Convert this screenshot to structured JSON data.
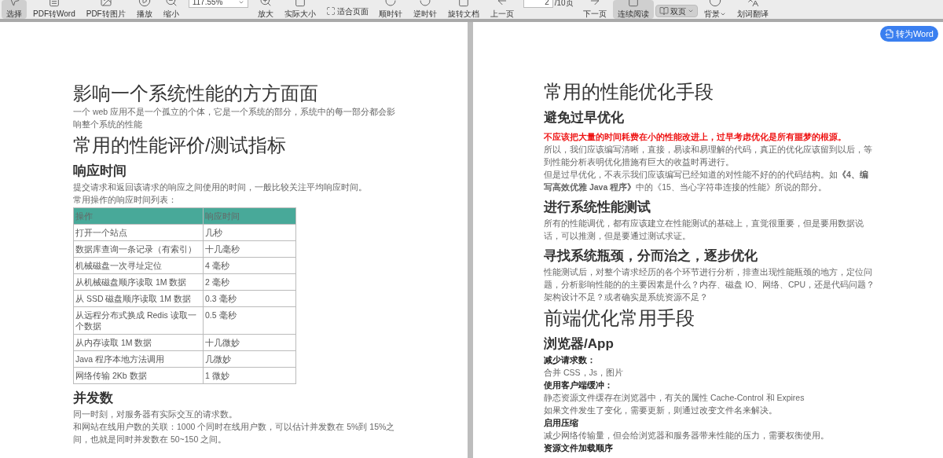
{
  "toolbar": [
    {
      "kind": "button",
      "label": "选择",
      "selected": true,
      "dropdown": false
    },
    {
      "kind": "button",
      "label": "PDF转Word",
      "selected": false,
      "dropdown": false
    },
    {
      "kind": "button",
      "label": "PDF转图片",
      "selected": false,
      "dropdown": false
    },
    {
      "kind": "button",
      "label": "播放",
      "selected": false,
      "dropdown": false
    },
    {
      "kind": "button",
      "label": "缩小",
      "selected": false,
      "dropdown": false
    },
    {
      "kind": "zoom",
      "value": "117.55%"
    },
    {
      "kind": "button",
      "label": "放大",
      "selected": false,
      "dropdown": false
    },
    {
      "kind": "button",
      "label": "实际大小",
      "selected": false,
      "dropdown": false
    },
    {
      "kind": "inline",
      "label": "适合页面",
      "selected": false,
      "dropdown": false
    },
    {
      "kind": "button",
      "label": "顺时针",
      "selected": false,
      "dropdown": false
    },
    {
      "kind": "button",
      "label": "逆时针",
      "selected": false,
      "dropdown": false
    },
    {
      "kind": "button",
      "label": "旋转文档",
      "selected": false,
      "dropdown": false
    },
    {
      "kind": "button",
      "label": "上一页",
      "selected": false,
      "dropdown": false
    },
    {
      "kind": "page",
      "value": "2",
      "total": "/10页"
    },
    {
      "kind": "button",
      "label": "下一页",
      "selected": false,
      "dropdown": false
    },
    {
      "kind": "button",
      "label": "连续阅读",
      "selected": true,
      "dropdown": false
    },
    {
      "kind": "inline",
      "label": "双页",
      "selected": true,
      "dropdown": true
    },
    {
      "kind": "button",
      "label": "背景",
      "selected": false,
      "dropdown": true
    },
    {
      "kind": "button",
      "label": "划词翻译",
      "selected": false,
      "dropdown": false
    }
  ],
  "left_page": {
    "blocks": [
      {
        "kind": "h1",
        "text": "影响一个系统性能的方方面面"
      },
      {
        "kind": "p",
        "text": "一个 web 应用不是一个孤立的个体，它是一个系统的部分，系统中的每一部分都会影响整个系统的性能"
      },
      {
        "kind": "h1",
        "text": "常用的性能评价/测试指标"
      },
      {
        "kind": "h2",
        "text": "响应时间"
      },
      {
        "kind": "p",
        "text": "提交请求和返回该请求的响应之间使用的时间，一般比较关注平均响应时间。"
      },
      {
        "kind": "p",
        "text": "常用操作的响应时间列表："
      },
      {
        "kind": "table",
        "columns": [
          "操作",
          "响应时间"
        ],
        "rows": [
          [
            "打开一个站点",
            "几秒"
          ],
          [
            "数据库查询一条记录（有索引）",
            "十几毫秒"
          ],
          [
            "机械磁盘一次寻址定位",
            "4 毫秒"
          ],
          [
            "从机械磁盘顺序读取 1M 数据",
            "2 毫秒"
          ],
          [
            "从 SSD 磁盘顺序读取 1M 数据",
            "0.3 毫秒"
          ],
          [
            "从远程分布式换成 Redis 读取一个数据",
            "0.5 毫秒"
          ],
          [
            "从内存读取 1M 数据",
            "十几微妙"
          ],
          [
            "Java 程序本地方法调用",
            "几微妙"
          ],
          [
            "网络传输 2Kb 数据",
            "1 微妙"
          ]
        ]
      },
      {
        "kind": "h2",
        "text": "并发数"
      },
      {
        "kind": "p",
        "text": "同一时刻，对服务器有实际交互的请求数。"
      },
      {
        "kind": "p",
        "text": "和网站在线用户数的关联：1000 个同时在线用户数，可以估计并发数在 5%到 15%之间，也就是同时并发数在 50~150 之间。"
      }
    ]
  },
  "right_page": {
    "convert_button": "转为Word",
    "blocks": [
      {
        "kind": "h1",
        "text": "常用的性能优化手段"
      },
      {
        "kind": "h2",
        "text": "避免过早优化"
      },
      {
        "kind": "alert",
        "text": "不应该把大量的时间耗费在小的性能改进上，过早考虑优化是所有噩梦的根源。"
      },
      {
        "kind": "p",
        "text": "所以，我们应该编写清晰，直接，易读和易理解的代码，真正的优化应该留到以后，等到性能分析表明优化措施有巨大的收益时再进行。"
      },
      {
        "kind": "p",
        "text": "但是过早优化，不表示我们应该编写已经知道的对性能不好的的代码结构。如**《4、编写高效优雅 Java 程序》**中的《15、当心字符串连接的性能》所说的部分。"
      },
      {
        "kind": "h2",
        "text": "进行系统性能测试"
      },
      {
        "kind": "p",
        "text": "所有的性能调优，都有应该建立在性能测试的基础上，直觉很重要，但是要用数据说话，可以推测，但是要通过测试求证。"
      },
      {
        "kind": "h2",
        "text": "寻找系统瓶颈，分而治之，逐步优化"
      },
      {
        "kind": "p",
        "text": "性能测试后，对整个请求经历的各个环节进行分析，排查出现性能瓶颈的地方，定位问题，分析影响性能的的主要因素是什么？内存、磁盘 IO、网络、CPU，还是代码问题？架构设计不足？或者确实是系统资源不足？"
      },
      {
        "kind": "h1",
        "text": "前端优化常用手段"
      },
      {
        "kind": "h2",
        "text": "浏览器/App"
      },
      {
        "kind": "label",
        "text": "减少请求数："
      },
      {
        "kind": "p",
        "text": "合并 CSS，Js，图片"
      },
      {
        "kind": "label",
        "text": "使用客户端缓冲："
      },
      {
        "kind": "p",
        "text": "静态资源文件缓存在浏览器中，有关的属性 Cache-Control 和 Expires"
      },
      {
        "kind": "p",
        "text": "如果文件发生了变化，需要更新，则通过改变文件名来解决。"
      },
      {
        "kind": "label",
        "text": "启用压缩"
      },
      {
        "kind": "p",
        "text": "减少网络传输量，但会给浏览器和服务器带来性能的压力，需要权衡使用。"
      },
      {
        "kind": "label",
        "text": "资源文件加载顺序"
      }
    ]
  }
}
